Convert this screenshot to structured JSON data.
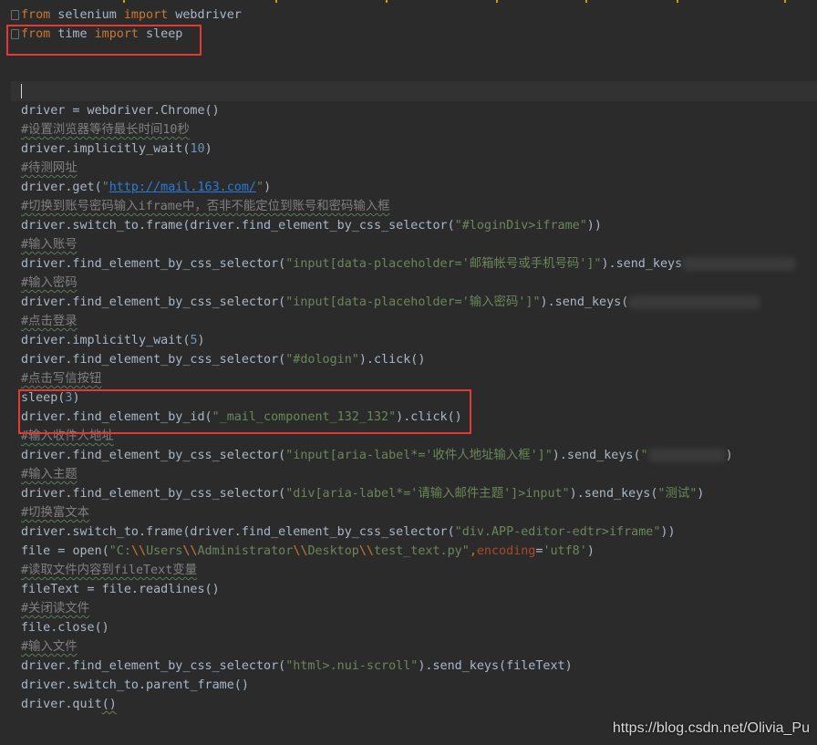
{
  "code": {
    "lines": [
      {
        "tokens": [
          {
            "t": "from",
            "c": "kw"
          },
          {
            "t": " selenium ",
            "c": "plain"
          },
          {
            "t": "import",
            "c": "kw"
          },
          {
            "t": " webdriver",
            "c": "plain"
          }
        ]
      },
      {
        "tokens": [
          {
            "t": "from",
            "c": "kw"
          },
          {
            "t": " time ",
            "c": "plain"
          },
          {
            "t": "import",
            "c": "kw"
          },
          {
            "t": " sleep",
            "c": "plain"
          }
        ]
      },
      {
        "tokens": []
      },
      {
        "tokens": []
      },
      {
        "tokens": [
          {
            "t": "driver = webdriver.Chrome()",
            "c": "plain"
          }
        ]
      },
      {
        "tokens": [
          {
            "t": "#设置浏览器等待最长时间10秒",
            "c": "cmt"
          }
        ]
      },
      {
        "tokens": [
          {
            "t": "driver.implicitly_wait(",
            "c": "plain"
          },
          {
            "t": "10",
            "c": "num"
          },
          {
            "t": ")",
            "c": "plain"
          }
        ]
      },
      {
        "tokens": [
          {
            "t": "#待测网址",
            "c": "cmt"
          }
        ]
      },
      {
        "tokens": [
          {
            "t": "driver.get(",
            "c": "plain"
          },
          {
            "t": "\"",
            "c": "str"
          },
          {
            "t": "http://mail.163.com/",
            "c": "url"
          },
          {
            "t": "\"",
            "c": "str"
          },
          {
            "t": ")",
            "c": "plain"
          }
        ]
      },
      {
        "tokens": [
          {
            "t": "#切换到账号密码输入iframe中，否非不能定位到账号和密码输入框",
            "c": "cmt"
          }
        ]
      },
      {
        "tokens": [
          {
            "t": "driver.switch_to.frame(driver.find_element_by_css_selector(",
            "c": "plain"
          },
          {
            "t": "\"#loginDiv>iframe\"",
            "c": "str"
          },
          {
            "t": "))",
            "c": "plain"
          }
        ]
      },
      {
        "tokens": [
          {
            "t": "#输入账号",
            "c": "cmt"
          }
        ]
      },
      {
        "tokens": [
          {
            "t": "driver.find_element_by_css_selector(",
            "c": "plain"
          },
          {
            "t": "\"input[data-placeholder='邮箱帐号或手机号码']\"",
            "c": "str"
          },
          {
            "t": ").send_keys",
            "c": "plain"
          },
          {
            "t": "",
            "c": "blur",
            "w": 125
          }
        ]
      },
      {
        "tokens": [
          {
            "t": "#输入密码",
            "c": "cmt"
          }
        ]
      },
      {
        "tokens": [
          {
            "t": "driver.find_element_by_css_selector(",
            "c": "plain"
          },
          {
            "t": "\"input[data-placeholder='输入密码']\"",
            "c": "str"
          },
          {
            "t": ").send_keys(",
            "c": "plain"
          },
          {
            "t": "",
            "c": "blur",
            "w": 145
          }
        ]
      },
      {
        "tokens": [
          {
            "t": "#点击登录",
            "c": "cmt"
          }
        ]
      },
      {
        "tokens": [
          {
            "t": "driver.implicitly_wait(",
            "c": "plain"
          },
          {
            "t": "5",
            "c": "num"
          },
          {
            "t": ")",
            "c": "plain"
          }
        ]
      },
      {
        "tokens": [
          {
            "t": "driver.find_element_by_css_selector(",
            "c": "plain"
          },
          {
            "t": "\"#dologin\"",
            "c": "str"
          },
          {
            "t": ").click()",
            "c": "plain"
          }
        ]
      },
      {
        "tokens": [
          {
            "t": "#点击写信按钮",
            "c": "cmt"
          }
        ]
      },
      {
        "tokens": [
          {
            "t": "sleep(",
            "c": "plain"
          },
          {
            "t": "3",
            "c": "num"
          },
          {
            "t": ")",
            "c": "plain"
          }
        ]
      },
      {
        "tokens": [
          {
            "t": "driver.find_element_by_id(",
            "c": "plain"
          },
          {
            "t": "\"_mail_component_132_132\"",
            "c": "str"
          },
          {
            "t": ").click()",
            "c": "plain"
          }
        ]
      },
      {
        "tokens": [
          {
            "t": "#输入收件人地址",
            "c": "cmt"
          }
        ]
      },
      {
        "tokens": [
          {
            "t": "driver.find_element_by_css_selector(",
            "c": "plain"
          },
          {
            "t": "\"input[aria-label*='收件人地址输入框']\"",
            "c": "str"
          },
          {
            "t": ").send_keys(",
            "c": "plain"
          },
          {
            "t": "\"",
            "c": "str"
          },
          {
            "t": "",
            "c": "blur",
            "w": 85
          },
          {
            "t": ")",
            "c": "plain"
          }
        ]
      },
      {
        "tokens": [
          {
            "t": "#输入主题",
            "c": "cmt"
          }
        ]
      },
      {
        "tokens": [
          {
            "t": "driver.find_element_by_css_selector(",
            "c": "plain"
          },
          {
            "t": "\"div[aria-label*='请输入邮件主题']>input\"",
            "c": "str"
          },
          {
            "t": ").send_keys(",
            "c": "plain"
          },
          {
            "t": "\"测试\"",
            "c": "str"
          },
          {
            "t": ")",
            "c": "plain"
          }
        ]
      },
      {
        "tokens": [
          {
            "t": "#切换富文本",
            "c": "cmt"
          }
        ]
      },
      {
        "tokens": [
          {
            "t": "driver.switch_to.frame(driver.find_element_by_css_selector(",
            "c": "plain"
          },
          {
            "t": "\"div.APP-editor-edtr>iframe\"",
            "c": "str"
          },
          {
            "t": "))",
            "c": "plain"
          }
        ]
      },
      {
        "tokens": [
          {
            "t": "file = ",
            "c": "plain"
          },
          {
            "t": "open",
            "c": "plain"
          },
          {
            "t": "(",
            "c": "plain"
          },
          {
            "t": "\"C:",
            "c": "str"
          },
          {
            "t": "\\\\",
            "c": "esc"
          },
          {
            "t": "Users",
            "c": "str"
          },
          {
            "t": "\\\\",
            "c": "esc"
          },
          {
            "t": "Administrator",
            "c": "str"
          },
          {
            "t": "\\\\",
            "c": "esc"
          },
          {
            "t": "Desktop",
            "c": "str"
          },
          {
            "t": "\\\\",
            "c": "esc"
          },
          {
            "t": "test_text.py\"",
            "c": "str"
          },
          {
            "t": ",",
            "c": "kw"
          },
          {
            "t": "encoding",
            "c": "param"
          },
          {
            "t": "=",
            "c": "plain"
          },
          {
            "t": "'utf8'",
            "c": "str"
          },
          {
            "t": ")",
            "c": "plain"
          }
        ]
      },
      {
        "tokens": [
          {
            "t": "#读取文件内容到fileText变量",
            "c": "cmt"
          }
        ]
      },
      {
        "tokens": [
          {
            "t": "fileText = file.readlines()",
            "c": "plain"
          }
        ]
      },
      {
        "tokens": [
          {
            "t": "#关闭读文件",
            "c": "cmt"
          }
        ]
      },
      {
        "tokens": [
          {
            "t": "file.close()",
            "c": "plain"
          }
        ]
      },
      {
        "tokens": [
          {
            "t": "#输入文件",
            "c": "cmt"
          }
        ]
      },
      {
        "tokens": [
          {
            "t": "driver.find_element_by_css_selector(",
            "c": "plain"
          },
          {
            "t": "\"html>.nui-scroll\"",
            "c": "str"
          },
          {
            "t": ").send_keys(fileText)",
            "c": "plain"
          }
        ]
      },
      {
        "tokens": [
          {
            "t": "driver.switch_to.parent_frame()",
            "c": "plain"
          }
        ]
      },
      {
        "tokens": [
          {
            "t": "driver.quit",
            "c": "plain"
          },
          {
            "t": "()",
            "c": "warn"
          }
        ]
      }
    ]
  },
  "watermark": "https://blog.csdn.net/Olivia_Pu"
}
